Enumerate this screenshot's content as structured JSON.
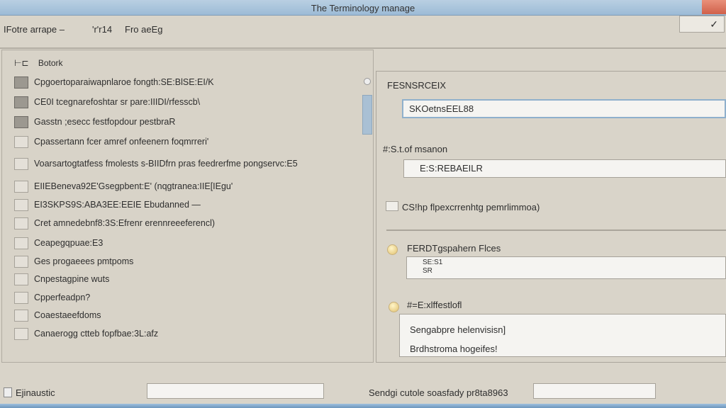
{
  "window": {
    "title": "The Terminology manage",
    "ok_icon": "checkmark-icon",
    "ok_label": "✓"
  },
  "menu": [
    "IFotre arrape  –",
    "'r'r14",
    "Fro aeEg"
  ],
  "left_panel": {
    "header": "Botork",
    "header_icon": "tree-icon",
    "items": [
      {
        "label": "Cpgoertoparaiwapnlaroe fongth:SE:BlSE:EI/K",
        "checked": true
      },
      {
        "label": "CE0I tcegnarefoshtar sr pare:IIIDI/rfesscb\\",
        "checked": true
      },
      {
        "label": "Gasstn ;esecc festfopdour pestbraR",
        "checked": true
      },
      {
        "label": "Cpassertann fcer amref onfeenern foqmrreri'",
        "checked": false
      },
      {
        "label": "Voarsartogtatfess fmolests s-BIIDfrn pras feedrerfme pongservc:E5",
        "checked": false
      },
      {
        "label": "EIIEBeneva92E'Gsegpbent:E'    (nqgtranea:IIE[IEgu'",
        "checked": false
      },
      {
        "label": "EI3SKPS9S:ABA3EE:EEIE Ebudanned —",
        "checked": false
      },
      {
        "label": "Cret amnedebnf8:3S:Efrenr erennreeeferencl)",
        "checked": false
      },
      {
        "label": "Ceapegqpuae:E3",
        "checked": false
      },
      {
        "label": "Ges progaeees pmtpoms",
        "checked": false
      },
      {
        "label": "Cnpestagpine wuts",
        "checked": false
      },
      {
        "label": "Cpperfeadpn?",
        "checked": false
      },
      {
        "label": "Coaestaeefdoms",
        "checked": false
      },
      {
        "label": "Canaerogg ctteb fopfbae:3L:afz",
        "checked": false
      }
    ]
  },
  "right_panel": {
    "field1_label": "FESNSRCEIX",
    "field1_value": "SKOetnsEEL88",
    "field2_label": "#:S.t.of msanon",
    "field2_value": "E:S:REBAEILR",
    "checkbox_label": "CS!hp flpexcrrenhtg pemrlimmoa)",
    "checkbox_checked": false,
    "radio1_label": "FERDTgspahern Flces",
    "radio1_value_line1": "SE:S1",
    "radio1_value_line2": "SR",
    "radio2_label": "#=E:xlffestlofl",
    "radio2_lines": [
      "Sengabpre helenvisisn]",
      "Brdhstroma hogeifes!"
    ]
  },
  "footer": {
    "checkbox_label": "Ejinaustic",
    "input1_value": "",
    "label2": "Sendgi cutole soasfady pr8ta8963",
    "input2_value": ""
  }
}
